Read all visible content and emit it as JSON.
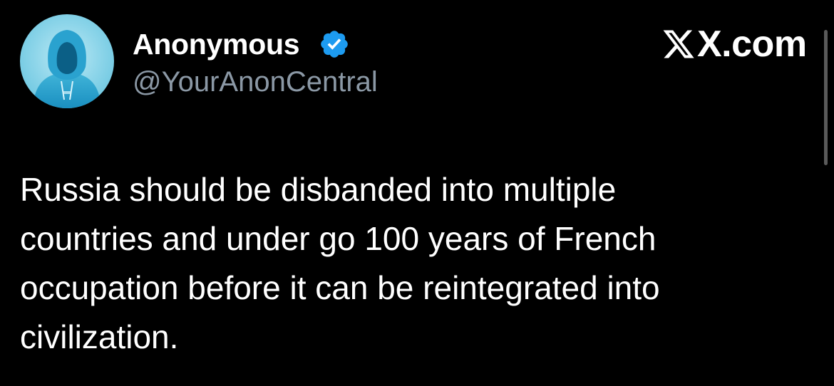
{
  "author": {
    "display_name": "Anonymous",
    "handle": "@YourAnonCentral",
    "verified": true,
    "verified_color": "#1d9bf0",
    "avatar_icon": "hooded-figure-avatar"
  },
  "brand": {
    "domain": "X.com"
  },
  "tweet": {
    "lines": [
      "Russia should be disbanded into multiple",
      "countries and under go 100 years of French",
      "occupation before it can be reintegrated into",
      "civilization."
    ]
  },
  "colors": {
    "background": "#000000",
    "text": "#ffffff",
    "handle": "#8b98a5",
    "avatar_bg": "#8fd6ea"
  }
}
